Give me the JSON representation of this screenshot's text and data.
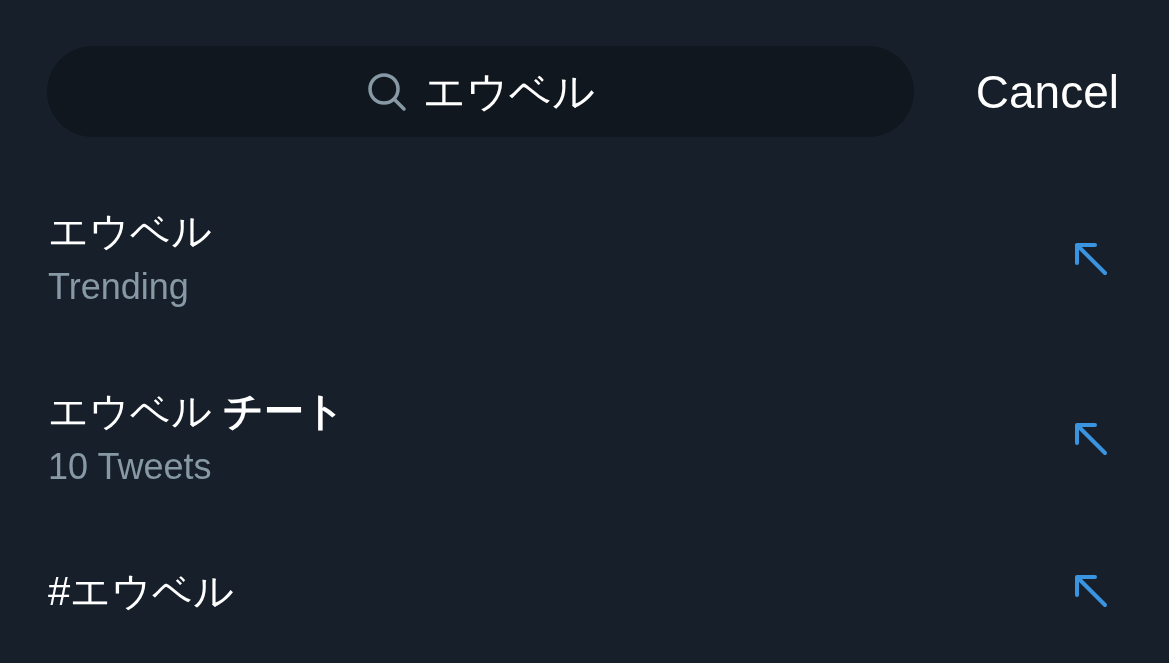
{
  "search": {
    "value": "エウベル"
  },
  "cancel": "Cancel",
  "suggestions": [
    {
      "title": "エウベル",
      "subtitle": "Trending"
    },
    {
      "title": "エウベル **チート**",
      "subtitle": "10 Tweets"
    },
    {
      "title": "#エウベル"
    }
  ]
}
